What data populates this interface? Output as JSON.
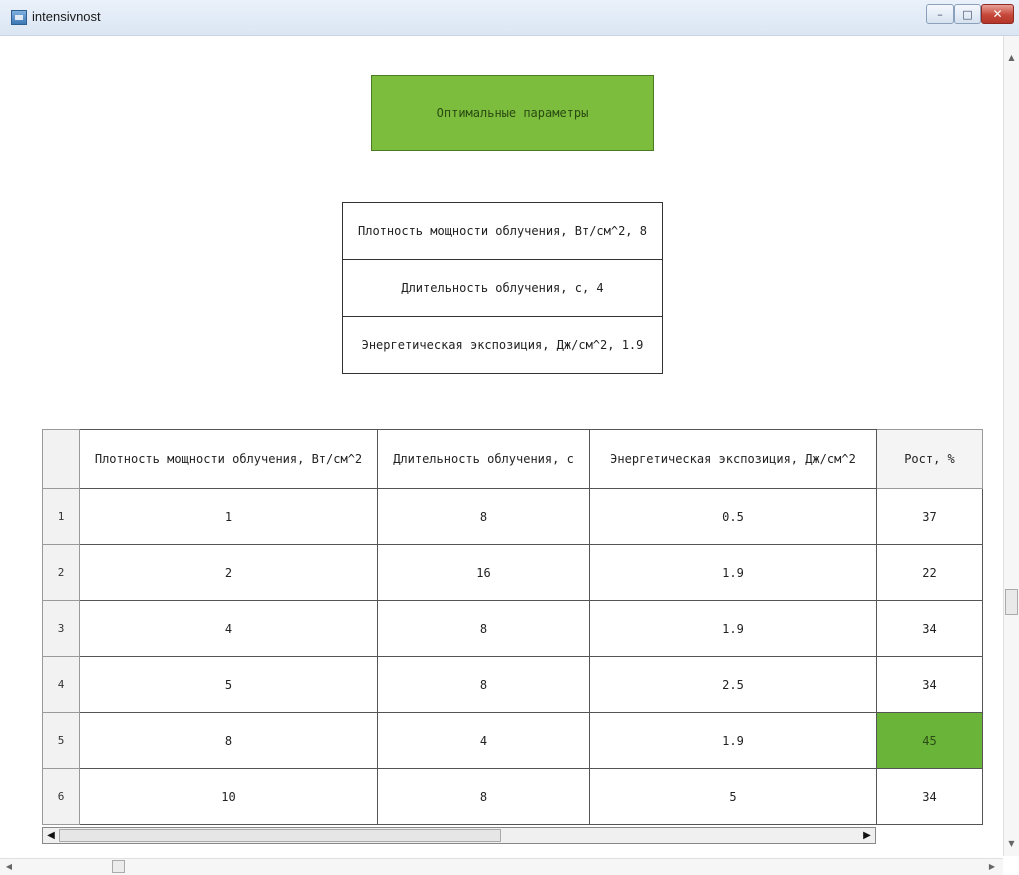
{
  "window": {
    "title": "intensivnost",
    "icon": "app-icon",
    "controls": {
      "minimize": "–",
      "maximize": "□",
      "close": "✕"
    }
  },
  "optimal_button": {
    "label": "Оптимальные параметры",
    "color": "#7cbd3e"
  },
  "summary": [
    "Плотность мощности облучения, Вт/см^2, 8",
    "Длительность облучения, с, 4",
    "Энергетическая экспозиция, Дж/см^2, 1.9"
  ],
  "table": {
    "headers": [
      "Плотность мощности облучения, Вт/см^2",
      "Длительность облучения, с",
      "Энергетическая экспозиция, Дж/см^2",
      "Рост, %"
    ],
    "rows": [
      {
        "num": "1",
        "cells": [
          "1",
          "8",
          "0.5",
          "37"
        ]
      },
      {
        "num": "2",
        "cells": [
          "2",
          "16",
          "1.9",
          "22"
        ]
      },
      {
        "num": "3",
        "cells": [
          "4",
          "8",
          "1.9",
          "34"
        ]
      },
      {
        "num": "4",
        "cells": [
          "5",
          "8",
          "2.5",
          "34"
        ]
      },
      {
        "num": "5",
        "cells": [
          "8",
          "4",
          "1.9",
          "45"
        ]
      },
      {
        "num": "6",
        "cells": [
          "10",
          "8",
          "5",
          "34"
        ]
      }
    ],
    "highlight_color": "#6bb43a"
  },
  "scroll_arrows": {
    "left": "◀",
    "right": "▶",
    "up": "▲",
    "down": "▼"
  }
}
